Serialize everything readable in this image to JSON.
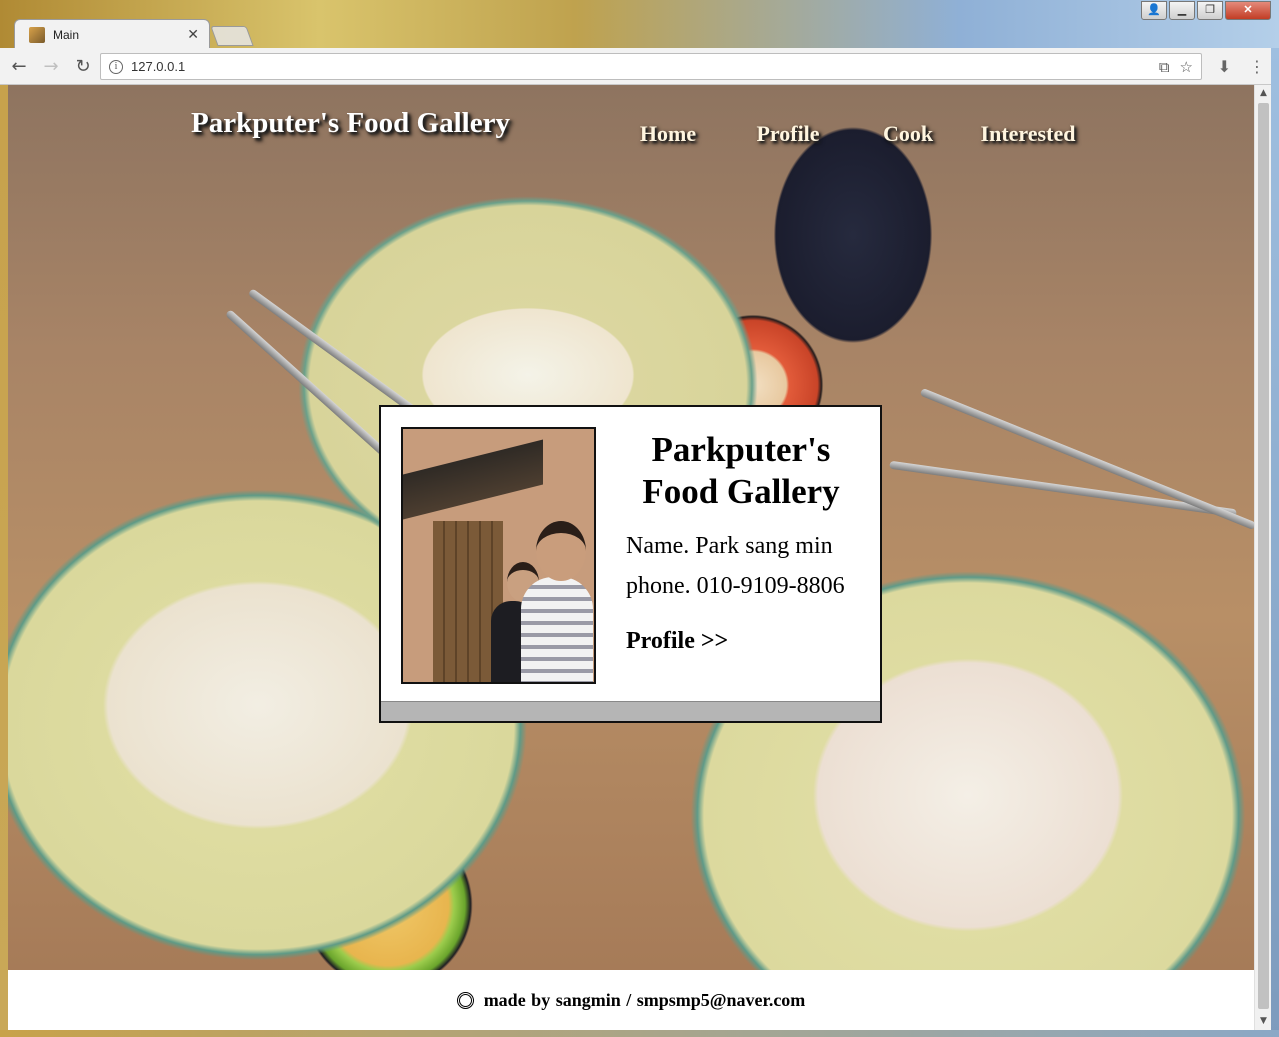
{
  "browser": {
    "tab_title": "Main",
    "tab_close": "✕",
    "url": "127.0.0.1",
    "window_buttons": {
      "user": "👤",
      "minimize": "▁",
      "maximize": "❐",
      "close": "✕"
    },
    "toolbar_icons": {
      "back": "back-arrow-icon",
      "forward": "forward-arrow-icon",
      "reload": "reload-icon",
      "info": "info-icon",
      "translate": "translate-icon",
      "bookmark": "star-icon",
      "download": "download-icon",
      "menu": "kebab-menu-icon"
    }
  },
  "site": {
    "title": "Parkputer's Food Gallery",
    "nav": [
      "Home",
      "Profile",
      "Cook",
      "Interested"
    ]
  },
  "card": {
    "title": "Parkputer's Food Gallery",
    "name_line": "Name. Park sang min",
    "phone_line": "phone. 010-9109-8806",
    "profile_link": "Profile >>"
  },
  "footer": {
    "text": "made by sangmin  /  smpsmp5@naver.com"
  },
  "colors": {
    "nav_text": "#fff5df",
    "card_border": "#111111",
    "card_footer": "#b5b5b5"
  }
}
